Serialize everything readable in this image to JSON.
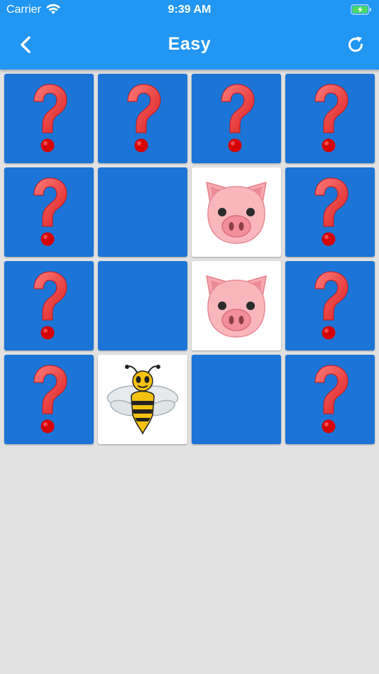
{
  "status": {
    "carrier": "Carrier",
    "time": "9:39 AM",
    "icons": [
      "wifi-icon",
      "battery-charging-icon"
    ]
  },
  "nav": {
    "title": "Easy",
    "back_icon": "chevron-left-icon",
    "refresh_icon": "refresh-icon"
  },
  "colors": {
    "header": "#2196f3",
    "card_back": "#1c74d6",
    "card_face": "#ffffff",
    "background": "#e2e2e2",
    "question_mark": "#e83a3a"
  },
  "board": {
    "rows": 4,
    "cols": 4,
    "cards": [
      {
        "state": "hidden",
        "icon": "question-mark-icon"
      },
      {
        "state": "hidden",
        "icon": "question-mark-icon"
      },
      {
        "state": "hidden",
        "icon": "question-mark-icon"
      },
      {
        "state": "hidden",
        "icon": "question-mark-icon"
      },
      {
        "state": "hidden",
        "icon": "question-mark-icon"
      },
      {
        "state": "matched",
        "icon": ""
      },
      {
        "state": "revealed",
        "icon": "pig-face-icon"
      },
      {
        "state": "hidden",
        "icon": "question-mark-icon"
      },
      {
        "state": "hidden",
        "icon": "question-mark-icon"
      },
      {
        "state": "matched",
        "icon": ""
      },
      {
        "state": "revealed",
        "icon": "pig-face-icon"
      },
      {
        "state": "hidden",
        "icon": "question-mark-icon"
      },
      {
        "state": "hidden",
        "icon": "question-mark-icon"
      },
      {
        "state": "revealed",
        "icon": "bee-icon"
      },
      {
        "state": "matched",
        "icon": ""
      },
      {
        "state": "hidden",
        "icon": "question-mark-icon"
      }
    ]
  }
}
